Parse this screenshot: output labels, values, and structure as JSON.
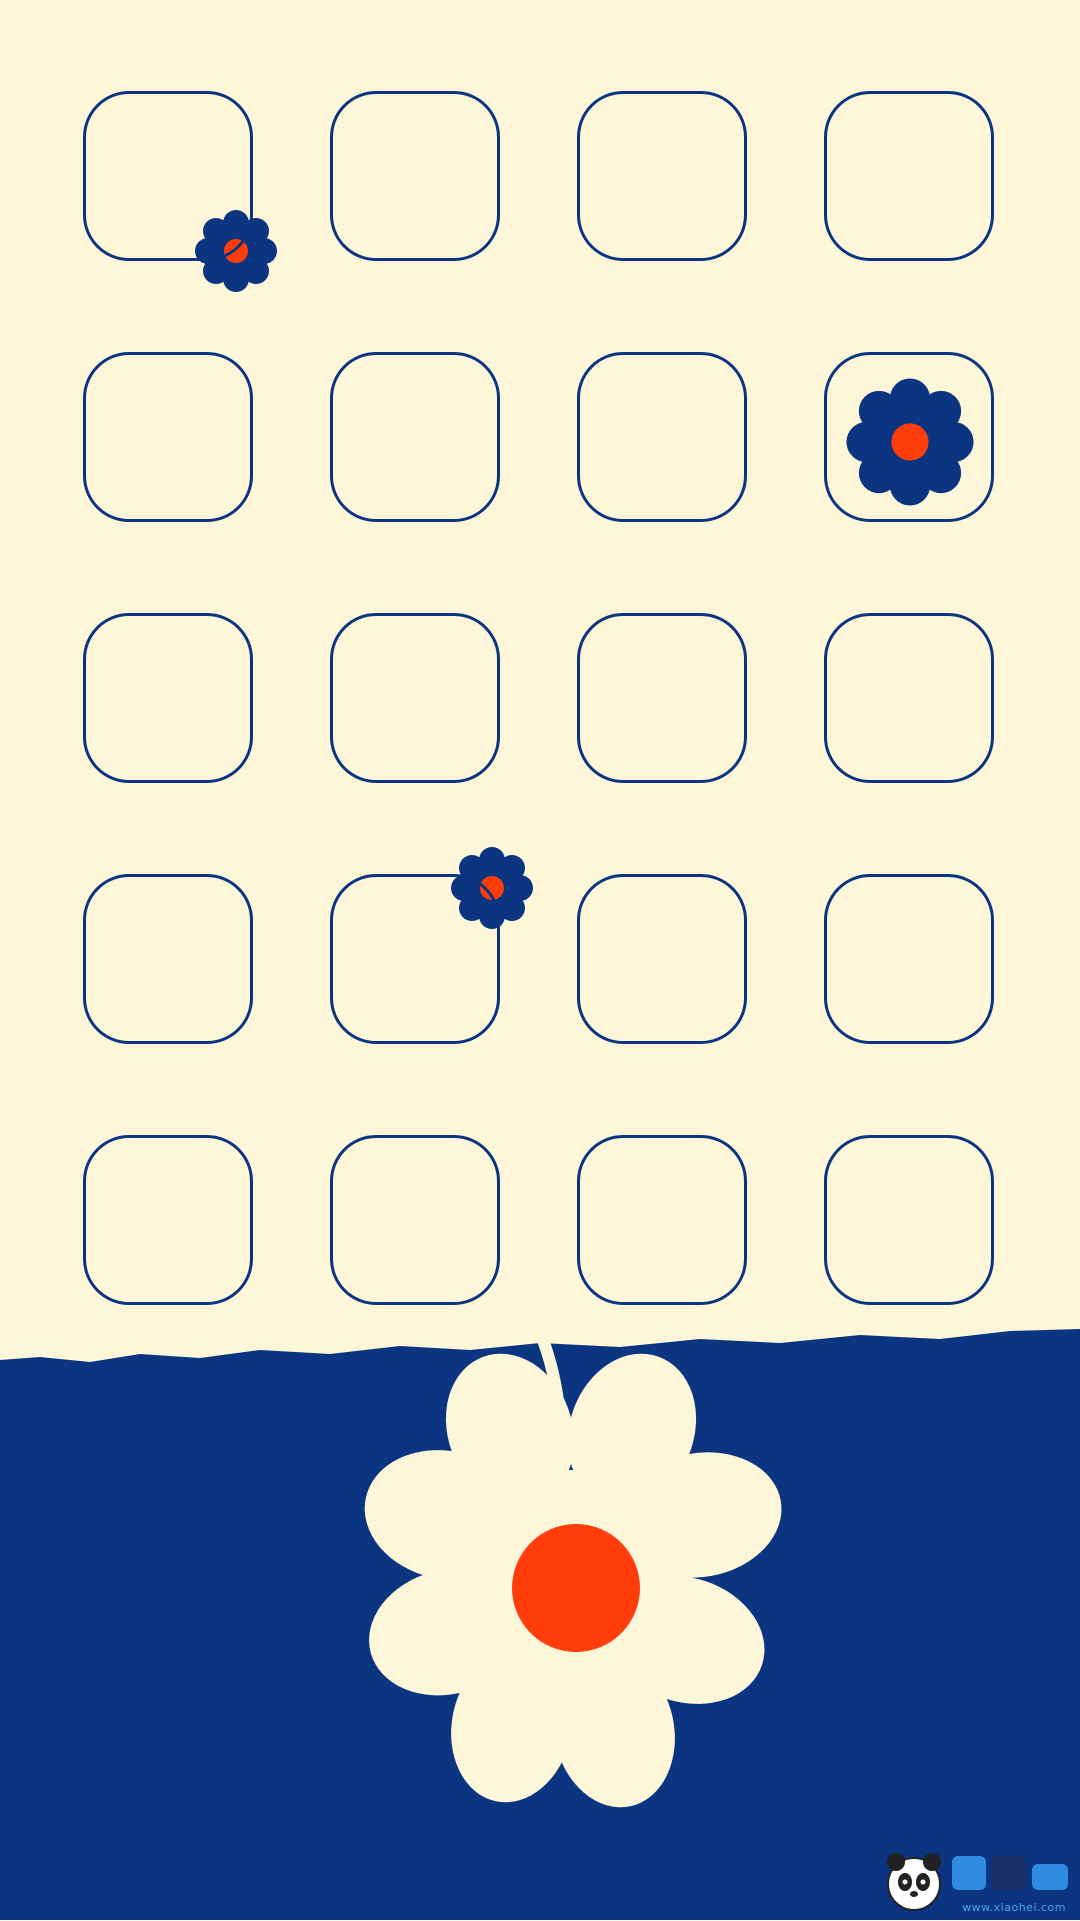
{
  "wallpaper": {
    "colors": {
      "cream": "#fdf6d8",
      "navy": "#0b3580",
      "orange": "#ff3d0a",
      "petal_light": "#fdf6d8"
    },
    "slot_grid": {
      "rows": 5,
      "columns": 4,
      "outline_color": "#0b3580"
    },
    "decorations": [
      {
        "name": "small-flower-icon",
        "description_icon": "daisy"
      },
      {
        "name": "flower-in-slot-icon",
        "description_icon": "daisy"
      },
      {
        "name": "small-flower-icon-2",
        "description_icon": "daisy"
      },
      {
        "name": "large-daisy-icon",
        "description_icon": "daisy"
      }
    ]
  },
  "watermark": {
    "logo_icon": "panda-logo",
    "text": "www.xiaohei.com"
  }
}
